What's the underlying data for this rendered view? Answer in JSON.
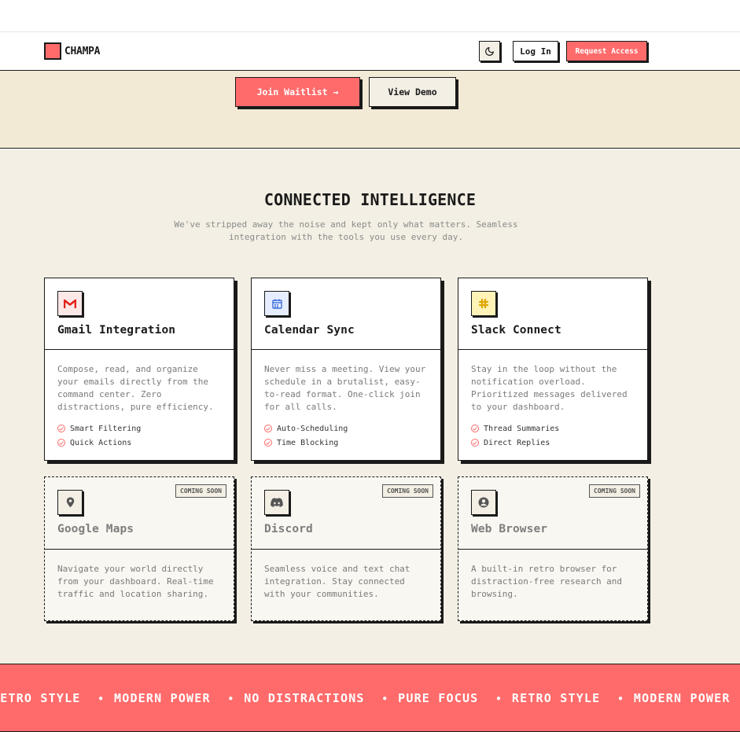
{
  "nav": {
    "brand": "CHAMPA",
    "theme_toggle_icon": "moon-icon",
    "login_label": "Log In",
    "request_label": "Request Access"
  },
  "hero": {
    "join_label": "Join Waitlist →",
    "demo_label": "View Demo"
  },
  "features": {
    "title": "CONNECTED INTELLIGENCE",
    "subtitle": "We've stripped away the noise and kept only what matters. Seamless integration with the tools you use every day.",
    "cards": [
      {
        "title": "Gmail Integration",
        "icon": "gmail-icon",
        "icon_bg": "#fde8e8",
        "description": "Compose, read, and organize your emails directly from the command center. Zero distractions, pure efficiency.",
        "features": [
          "Smart Filtering",
          "Quick Actions"
        ]
      },
      {
        "title": "Calendar Sync",
        "icon": "calendar-icon",
        "icon_bg": "#e6edff",
        "description": "Never miss a meeting. View your schedule in a brutalist, easy-to-read format. One-click join for all calls.",
        "features": [
          "Auto-Scheduling",
          "Time Blocking"
        ]
      },
      {
        "title": "Slack Connect",
        "icon": "slack-icon",
        "icon_bg": "#fff3b8",
        "description": "Stay in the loop without the notification overload. Prioritized messages delivered to your dashboard.",
        "features": [
          "Thread Summaries",
          "Direct Replies"
        ]
      },
      {
        "title": "Google Maps",
        "icon": "map-pin-icon",
        "badge": "COMING SOON",
        "description": "Navigate your world directly from your dashboard. Real-time traffic and location sharing."
      },
      {
        "title": "Discord",
        "icon": "discord-icon",
        "badge": "COMING SOON",
        "description": "Seamless voice and text chat integration. Stay connected with your communities."
      },
      {
        "title": "Web Browser",
        "icon": "user-circle-icon",
        "badge": "COMING SOON",
        "description": "A built-in retro browser for distraction-free research and browsing."
      }
    ]
  },
  "marquee": {
    "items": [
      "RETRO STYLE",
      "MODERN POWER",
      "NO DISTRACTIONS",
      "PURE FOCUS",
      "RETRO STYLE",
      "MODERN POWER"
    ]
  },
  "colors": {
    "accent": "#ff6b6b",
    "background": "#f3efe4",
    "hero_background": "#f3ead6",
    "ink": "#1a1a1a"
  }
}
